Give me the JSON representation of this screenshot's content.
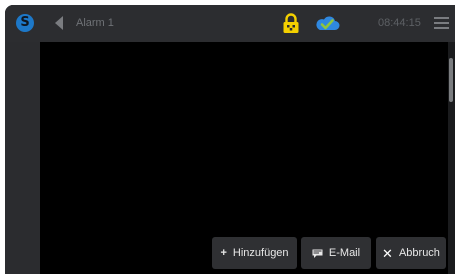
{
  "topbar": {
    "title": "Alarm 1",
    "time": "08:44:15",
    "icons": {
      "logo": "app-logo-icon",
      "back": "back-arrow-icon",
      "lock": "lock-icon",
      "cloud": "cloud-check-icon",
      "menu": "hamburger-menu-icon"
    },
    "colors": {
      "lock": "#f4d000",
      "cloud": "#2f88e0",
      "cloud_check": "#8fc53e",
      "logo": "#1d78c8"
    }
  },
  "footer": {
    "buttons": [
      {
        "label": "Hinzufügen",
        "icon": "plus-icon"
      },
      {
        "label": "E-Mail",
        "icon": "email-icon"
      },
      {
        "label": "Abbruch",
        "icon": "close-icon"
      }
    ]
  }
}
